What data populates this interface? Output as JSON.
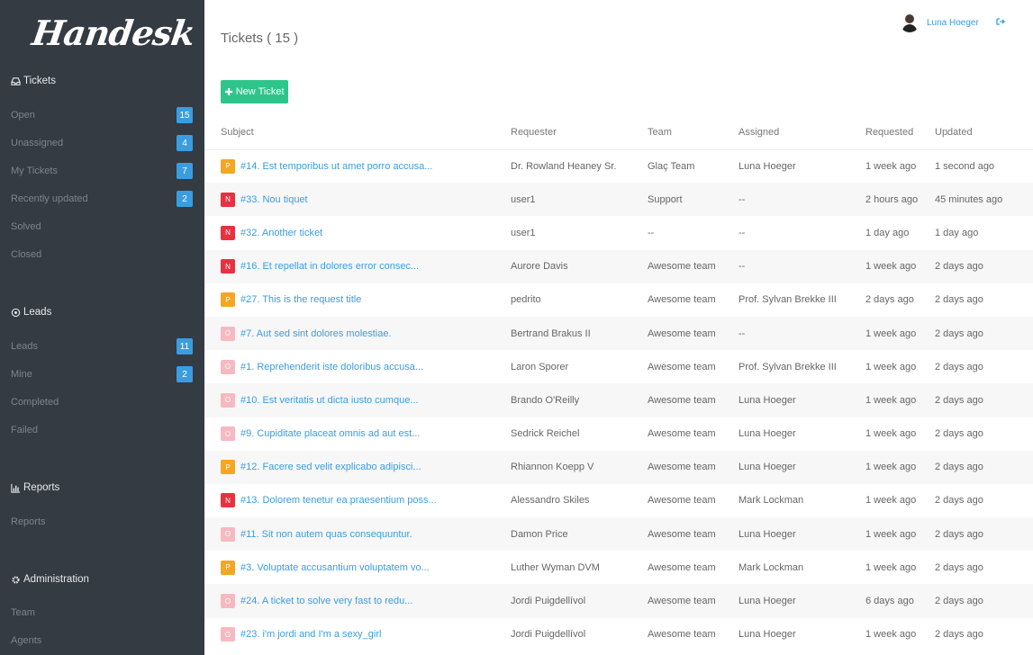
{
  "app": {
    "logo": "Handesk"
  },
  "sidebar": {
    "tickets": {
      "title": "Tickets",
      "items": [
        {
          "label": "Open",
          "badge": "15"
        },
        {
          "label": "Unassigned",
          "badge": "4"
        },
        {
          "label": "My Tickets",
          "badge": "7"
        },
        {
          "label": "Recently updated",
          "badge": "2"
        },
        {
          "label": "Solved",
          "badge": null
        },
        {
          "label": "Closed",
          "badge": null
        }
      ]
    },
    "leads": {
      "title": "Leads",
      "items": [
        {
          "label": "Leads",
          "badge": "11"
        },
        {
          "label": "Mine",
          "badge": "2"
        },
        {
          "label": "Completed",
          "badge": null
        },
        {
          "label": "Failed",
          "badge": null
        }
      ]
    },
    "reports": {
      "title": "Reports",
      "items": [
        {
          "label": "Reports"
        }
      ]
    },
    "admin": {
      "title": "Administration",
      "items": [
        {
          "label": "Team"
        },
        {
          "label": "Agents"
        }
      ]
    }
  },
  "header": {
    "title": "Tickets ( 15 )",
    "user_name": "Luna Hoeger",
    "new_ticket_label": "New Ticket"
  },
  "table": {
    "columns": [
      "Subject",
      "Requester",
      "Team",
      "Assigned",
      "Requested",
      "Updated"
    ],
    "rows": [
      {
        "status": "P",
        "subject": "#14. Est temporibus ut amet porro accusa...",
        "requester": "Dr. Rowland Heaney Sr.",
        "team": "Glaç Team",
        "assigned": "Luna Hoeger",
        "requested": "1 week ago",
        "updated": "1 second ago"
      },
      {
        "status": "N",
        "subject": "#33. Nou tiquet",
        "requester": "user1",
        "team": "Support",
        "assigned": "--",
        "requested": "2 hours ago",
        "updated": "45 minutes ago"
      },
      {
        "status": "N",
        "subject": "#32. Another ticket",
        "requester": "user1",
        "team": "--",
        "assigned": "--",
        "requested": "1 day ago",
        "updated": "1 day ago"
      },
      {
        "status": "N",
        "subject": "#16. Et repellat in dolores error consec...",
        "requester": "Aurore Davis",
        "team": "Awesome team",
        "assigned": "--",
        "requested": "1 week ago",
        "updated": "2 days ago"
      },
      {
        "status": "P",
        "subject": "#27. This is the request title",
        "requester": "pedrito",
        "team": "Awesome team",
        "assigned": "Prof. Sylvan Brekke III",
        "requested": "2 days ago",
        "updated": "2 days ago"
      },
      {
        "status": "O",
        "subject": "#7. Aut sed sint dolores molestiae.",
        "requester": "Bertrand Brakus II",
        "team": "Awesome team",
        "assigned": "--",
        "requested": "1 week ago",
        "updated": "2 days ago"
      },
      {
        "status": "O",
        "subject": "#1. Reprehenderit iste doloribus accusa...",
        "requester": "Laron Sporer",
        "team": "Awesome team",
        "assigned": "Prof. Sylvan Brekke III",
        "requested": "1 week ago",
        "updated": "2 days ago"
      },
      {
        "status": "O",
        "subject": "#10. Est veritatis ut dicta iusto cumque...",
        "requester": "Brando O'Reilly",
        "team": "Awesome team",
        "assigned": "Luna Hoeger",
        "requested": "1 week ago",
        "updated": "2 days ago"
      },
      {
        "status": "O",
        "subject": "#9. Cupiditate placeat omnis ad aut est...",
        "requester": "Sedrick Reichel",
        "team": "Awesome team",
        "assigned": "Luna Hoeger",
        "requested": "1 week ago",
        "updated": "2 days ago"
      },
      {
        "status": "P",
        "subject": "#12. Facere sed velit explicabo adipisci...",
        "requester": "Rhiannon Koepp V",
        "team": "Awesome team",
        "assigned": "Luna Hoeger",
        "requested": "1 week ago",
        "updated": "2 days ago"
      },
      {
        "status": "N",
        "subject": "#13. Dolorem tenetur ea praesentium poss...",
        "requester": "Alessandro Skiles",
        "team": "Awesome team",
        "assigned": "Mark Lockman",
        "requested": "1 week ago",
        "updated": "2 days ago"
      },
      {
        "status": "O",
        "subject": "#11. Sit non autem quas consequuntur.",
        "requester": "Damon Price",
        "team": "Awesome team",
        "assigned": "Luna Hoeger",
        "requested": "1 week ago",
        "updated": "2 days ago"
      },
      {
        "status": "P",
        "subject": "#3. Voluptate accusantium voluptatem vo...",
        "requester": "Luther Wyman DVM",
        "team": "Awesome team",
        "assigned": "Mark Lockman",
        "requested": "1 week ago",
        "updated": "2 days ago"
      },
      {
        "status": "O",
        "subject": "#24. A ticket to solve very fast to redu...",
        "requester": "Jordi Puigdellívol",
        "team": "Awesome team",
        "assigned": "Luna Hoeger",
        "requested": "6 days ago",
        "updated": "2 days ago"
      },
      {
        "status": "O",
        "subject": "#23. i'm jordi and I'm a sexy_girl",
        "requester": "Jordi Puigdellívol",
        "team": "Awesome team",
        "assigned": "Luna Hoeger",
        "requested": "1 week ago",
        "updated": "2 days ago"
      }
    ]
  },
  "colors": {
    "sidebar_bg": "#343b43",
    "accent": "#3a9de0",
    "button": "#2ec58b",
    "priority_P": "#f5a623",
    "priority_N": "#e8313f",
    "priority_O": "#f7b9c1"
  }
}
